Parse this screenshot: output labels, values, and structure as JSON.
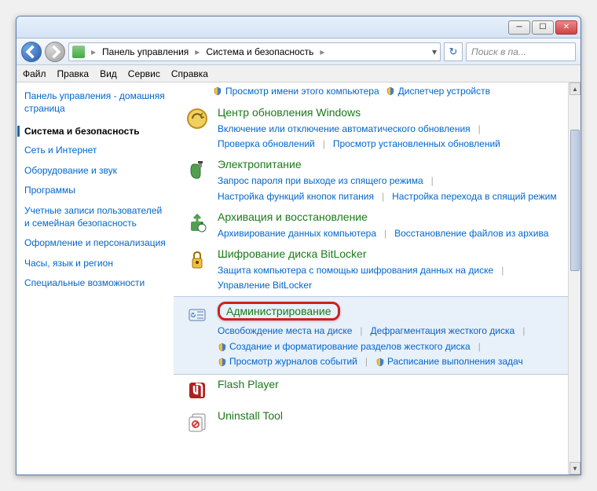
{
  "breadcrumb": {
    "root": "Панель управления",
    "current": "Система и безопасность"
  },
  "search": {
    "placeholder": "Поиск в па..."
  },
  "menu": {
    "file": "Файл",
    "edit": "Правка",
    "view": "Вид",
    "service": "Сервис",
    "help": "Справка"
  },
  "sidebar": {
    "home": "Панель управления - домашняя страница",
    "current": "Система и безопасность",
    "links": [
      "Сеть и Интернет",
      "Оборудование и звук",
      "Программы",
      "Учетные записи пользователей и семейная безопасность",
      "Оформление и персонализация",
      "Часы, язык и регион",
      "Специальные возможности"
    ]
  },
  "toprow": {
    "left": "Просмотр имени этого компьютера",
    "right": "Диспетчер устройств"
  },
  "sections": [
    {
      "title": "Центр обновления Windows",
      "links": [
        "Включение или отключение автоматического обновления",
        "Проверка обновлений",
        "Просмотр установленных обновлений"
      ],
      "shields": [
        false,
        false,
        false
      ]
    },
    {
      "title": "Электропитание",
      "links": [
        "Запрос пароля при выходе из спящего режима",
        "Настройка функций кнопок питания",
        "Настройка перехода в спящий режим"
      ],
      "shields": [
        false,
        false,
        false
      ]
    },
    {
      "title": "Архивация и восстановление",
      "links": [
        "Архивирование данных компьютера",
        "Восстановление файлов из архива"
      ],
      "shields": [
        false,
        false
      ]
    },
    {
      "title": "Шифрование диска BitLocker",
      "links": [
        "Защита компьютера с помощью шифрования данных на диске",
        "Управление BitLocker"
      ],
      "shields": [
        false,
        false
      ]
    },
    {
      "title": "Администрирование",
      "links": [
        "Освобождение места на диске",
        "Дефрагментация жесткого диска",
        "Создание и форматирование разделов жесткого диска",
        "Просмотр журналов событий",
        "Расписание выполнения задач"
      ],
      "shields": [
        false,
        false,
        true,
        true,
        true
      ],
      "highlighted": true
    },
    {
      "title": "Flash Player",
      "links": [],
      "shields": []
    },
    {
      "title": "Uninstall Tool",
      "links": [],
      "shields": []
    }
  ]
}
